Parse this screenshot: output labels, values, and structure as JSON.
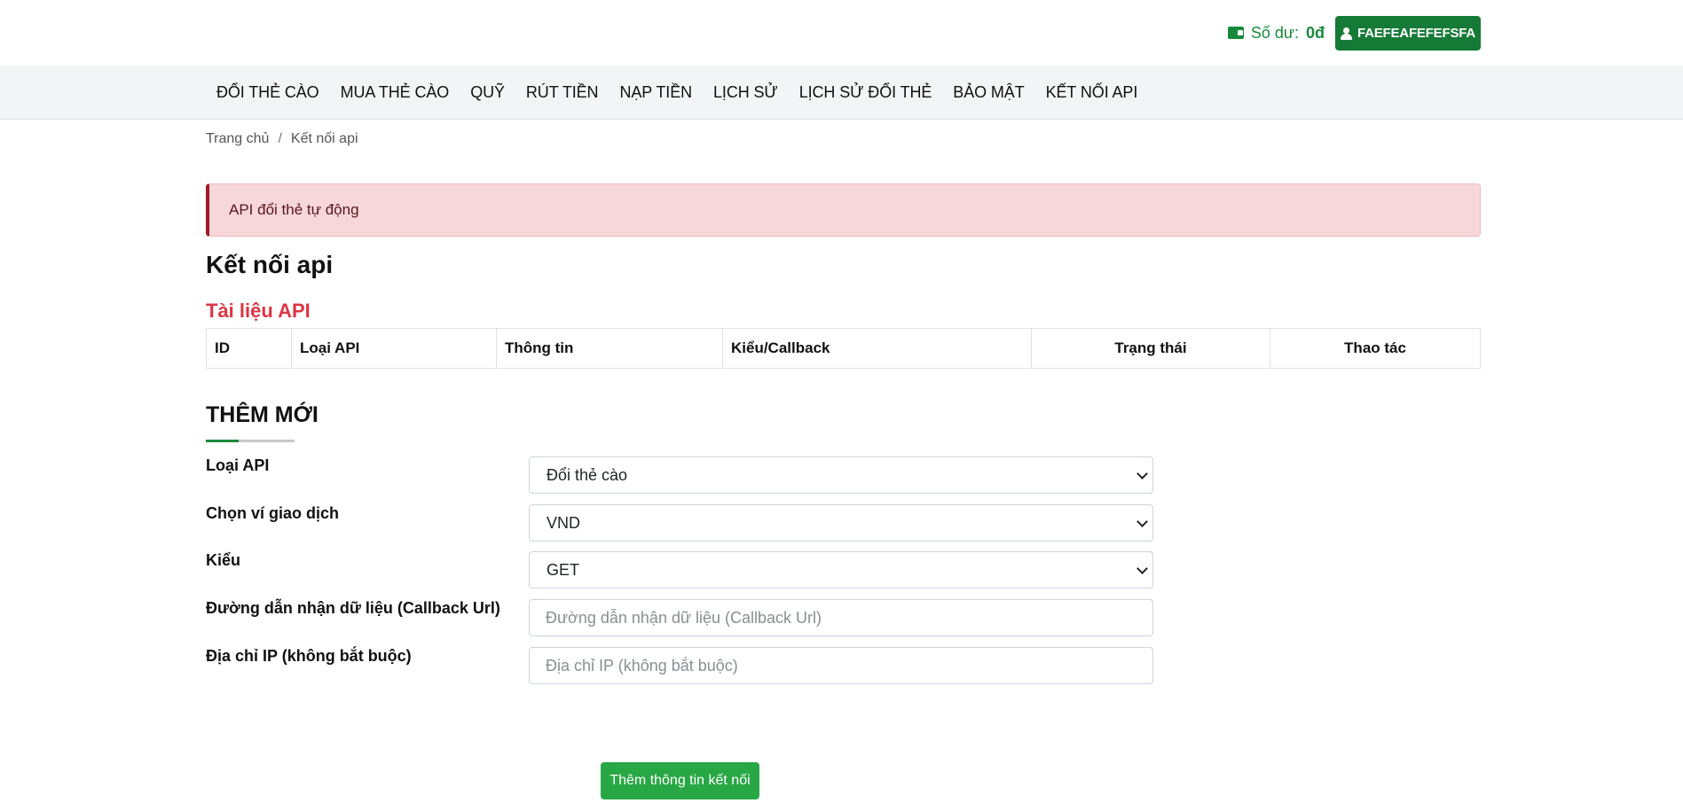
{
  "header": {
    "balance_label": "Số dư:",
    "balance_value": "0đ",
    "username": "FAEFEAFEFEFSFA"
  },
  "nav": {
    "items": [
      {
        "label": "ĐỔI THẺ CÀO"
      },
      {
        "label": "MUA THẺ CÀO"
      },
      {
        "label": "QUỸ"
      },
      {
        "label": "RÚT TIỀN"
      },
      {
        "label": "NẠP TIỀN"
      },
      {
        "label": "LỊCH SỬ"
      },
      {
        "label": "LỊCH SỬ ĐỔI THẺ"
      },
      {
        "label": "BẢO MẬT"
      },
      {
        "label": "KẾT NỐI API"
      }
    ]
  },
  "breadcrumb": {
    "home": "Trang chủ",
    "separator": "/",
    "current": "Kết nối api"
  },
  "alert": {
    "text": "API đổi thẻ tự động"
  },
  "page_title": "Kết nối api",
  "doc_title": "Tài liệu API",
  "table": {
    "columns": [
      "ID",
      "Loại API",
      "Thông tin",
      "Kiểu/Callback",
      "Trạng thái",
      "Thao tác"
    ]
  },
  "form": {
    "section_title": "THÊM MỚI",
    "api_type": {
      "label": "Loại API",
      "value": "Đổi thẻ cào"
    },
    "wallet": {
      "label": "Chọn ví giao dịch",
      "value": "VND"
    },
    "method": {
      "label": "Kiểu",
      "value": "GET"
    },
    "callback": {
      "label": "Đường dẫn nhận dữ liệu (Callback Url)",
      "placeholder": "Đường dẫn nhận dữ liệu (Callback Url)"
    },
    "ip": {
      "label": "Địa chỉ IP (không bắt buộc)",
      "placeholder": "Địa chỉ IP (không bắt buộc)"
    },
    "submit_label": "Thêm thông tin kết nối"
  },
  "colors": {
    "brand_green": "#157a36",
    "submit_green": "#28a745",
    "danger": "#dc3545",
    "alert_bg": "#f8d7da"
  },
  "icons": {
    "balance": "wallet-icon",
    "user": "user-icon",
    "select": "chevron-down-icon"
  }
}
